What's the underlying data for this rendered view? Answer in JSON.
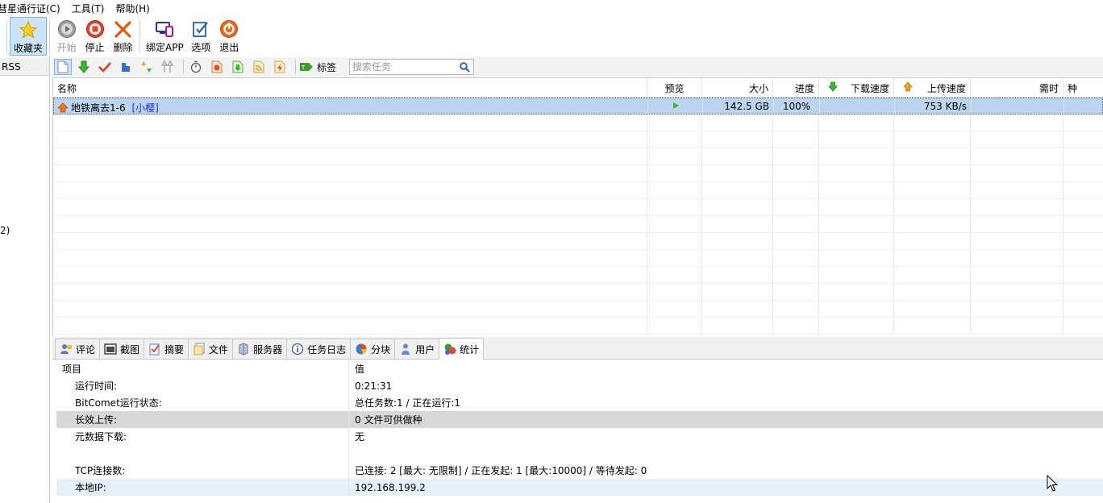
{
  "menu": [
    "彗星通行证(C)",
    "工具(T)",
    "帮助(H)"
  ],
  "toolbar": {
    "favorites": "收藏夹",
    "start": "开始",
    "stop": "停止",
    "delete": "删除",
    "bind_app": "绑定APP",
    "options": "选项",
    "exit": "退出"
  },
  "sidebar": {
    "rss": "RSS",
    "fragment": "2)"
  },
  "subbar": {
    "tags_label": "标签",
    "search_placeholder": "搜索任务"
  },
  "task_table": {
    "columns": {
      "name": "名称",
      "preview": "预览",
      "size": "大小",
      "progress": "进度",
      "download_speed": "下载速度",
      "upload_speed": "上传速度",
      "eta": "需时",
      "seeds": "种"
    },
    "rows": [
      {
        "name": "地铁离去1-6",
        "tag": "[小樱]",
        "size": "142.5 GB",
        "progress": "100%",
        "download_speed": "",
        "upload_speed": "753 KB/s",
        "eta": ""
      }
    ]
  },
  "tabs": {
    "comments": "评论",
    "screenshots": "截图",
    "summary": "摘要",
    "files": "文件",
    "servers": "服务器",
    "log": "任务日志",
    "pieces": "分块",
    "peers": "用户",
    "stats": "统计"
  },
  "stats": {
    "header_key": "项目",
    "header_value": "值",
    "rows": [
      {
        "key": "运行时间:",
        "value": "0:21:31"
      },
      {
        "key": "BitComet运行状态:",
        "value": "总任务数:1 / 正在运行:1"
      },
      {
        "key": "长效上传:",
        "value": "0 文件可供做种"
      },
      {
        "key": "元数据下载:",
        "value": "无"
      },
      {
        "key": "",
        "value": ""
      },
      {
        "key": "TCP连接数:",
        "value": "已连接: 2 [最大: 无限制] / 正在发起: 1 [最大:10000] / 等待发起: 0"
      },
      {
        "key": "本地IP:",
        "value": "192.168.199.2"
      }
    ]
  },
  "colors": {
    "selection": "#bcd4ee",
    "link": "#1a35c8",
    "stats_highlight": "#d8d8d8",
    "stats_row_blue": "#e4f1fb"
  }
}
